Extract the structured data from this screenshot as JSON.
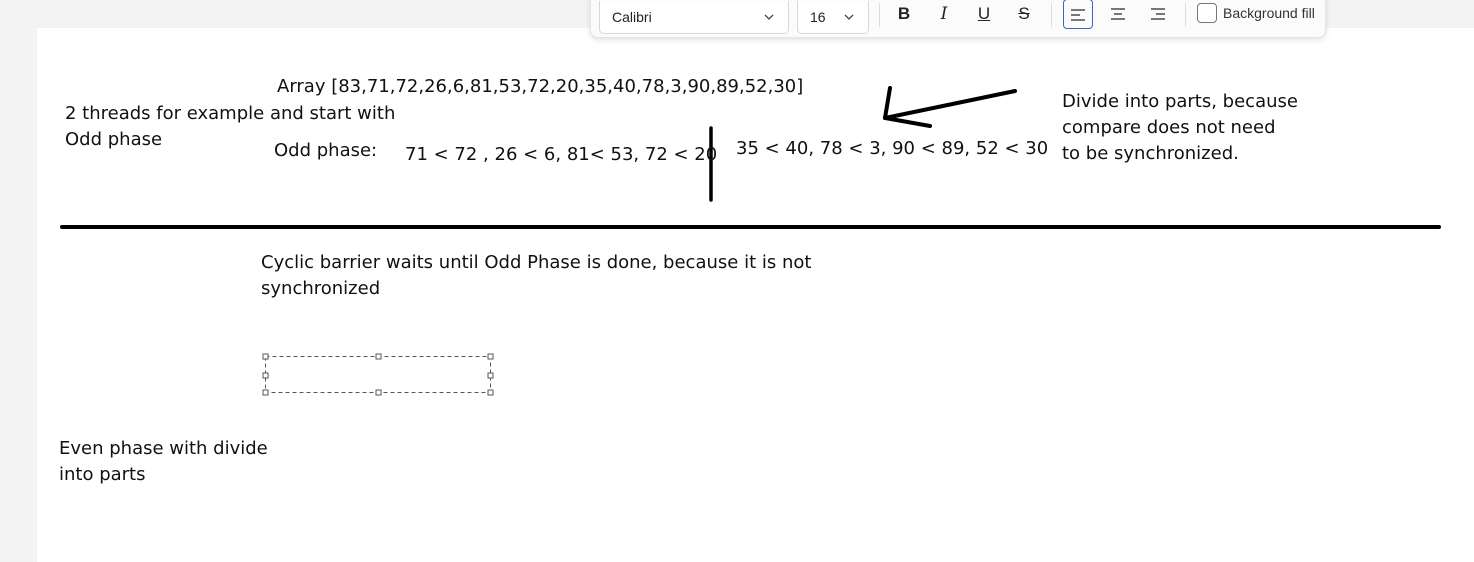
{
  "note": {
    "array_line": "Array [83,71,72,26,6,81,53,72,20,35,40,78,3,90,89,52,30]",
    "threads_line1": "2 threads for example and start with",
    "threads_line2": "Odd phase",
    "odd_label": "Odd phase:",
    "odd_part1": "71 < 72 , 26 < 6, 81< 53, 72 < 20",
    "odd_part2": "35 < 40, 78 < 3, 90 < 89, 52 < 30",
    "divide_line1": "Divide into parts, because",
    "divide_line2": "compare does not need",
    "divide_line3": "to be synchronized.",
    "barrier_line1": "Cyclic barrier waits until Odd Phase is done, because it is not",
    "barrier_line2": "synchronized",
    "even_line1": "Even phase with divide",
    "even_line2": "into parts"
  },
  "toolbar": {
    "font_name": "Calibri",
    "font_size": "16",
    "bold_label": "B",
    "italic_label": "I",
    "underline_label": "U",
    "strike_label": "S",
    "background_fill_label": "Background fill",
    "background_fill_checked": false,
    "align_selected": "left"
  },
  "colors": {
    "ink": "#000000",
    "accent": "#3a66c4"
  }
}
